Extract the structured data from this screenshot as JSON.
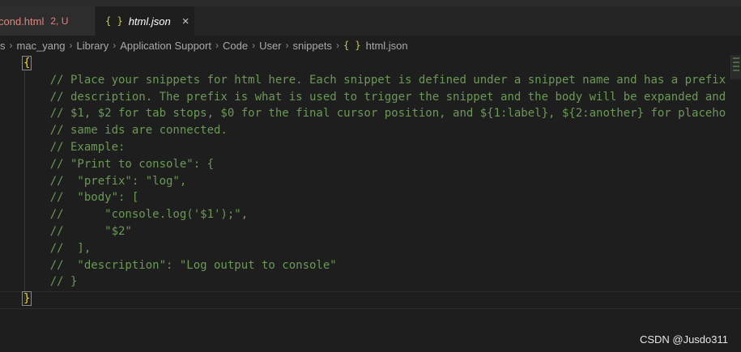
{
  "tabs": {
    "inactive": {
      "name": "cond.html",
      "status": "2, U"
    },
    "active": {
      "icon": "{ }",
      "name": "html.json",
      "close": "×"
    }
  },
  "breadcrumbs": {
    "items": [
      "s",
      "mac_yang",
      "Library",
      "Application Support",
      "Code",
      "User",
      "snippets"
    ],
    "file_icon": "{ }",
    "file": "html.json",
    "separator": "›"
  },
  "code_lines": [
    "{",
    "    // Place your snippets for html here. Each snippet is defined under a snippet name and has a prefix",
    "    // description. The prefix is what is used to trigger the snippet and the body will be expanded and",
    "    // $1, $2 for tab stops, $0 for the final cursor position, and ${1:label}, ${2:another} for placeho",
    "    // same ids are connected.",
    "    // Example:",
    "    // \"Print to console\": {",
    "    //  \"prefix\": \"log\",",
    "    //  \"body\": [",
    "    //      \"console.log('$1');\",",
    "    //      \"$2\"",
    "    //  ],",
    "    //  \"description\": \"Log output to console\"",
    "    // }",
    "}"
  ],
  "watermark": "CSDN @Jusdo311"
}
